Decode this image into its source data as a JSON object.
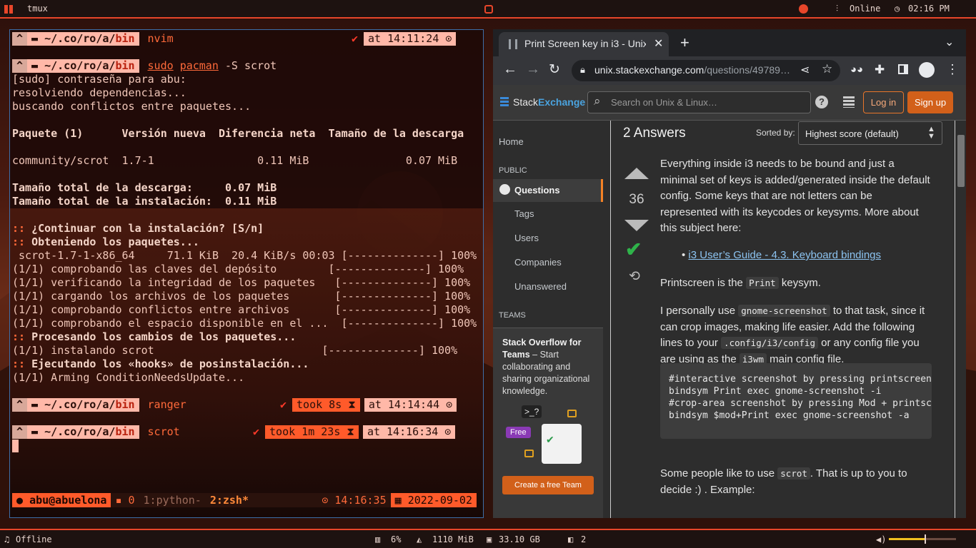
{
  "topbar": {
    "app": "tmux",
    "status": "Online",
    "clock": "02:16 PM"
  },
  "bottombar": {
    "music": "Offline",
    "cpu": "6%",
    "mem": "1110 MiB",
    "disk": "33.10 GB",
    "windows": "2"
  },
  "terminal": {
    "prompt_path": "~/.co/ro/a/",
    "prompt_bin": "bin",
    "prompt1": {
      "cmd": "nvim",
      "at": "at 14:11:24"
    },
    "prompt2": {
      "sudo": "sudo",
      "pacman": "pacman",
      "args": " -S scrot"
    },
    "lines": [
      "[sudo] contraseña para abu:",
      "resolviendo dependencias...",
      "buscando conflictos entre paquetes..."
    ],
    "table_header": "Paquete (1)      Versión nueva  Diferencia neta  Tamaño de la descarga",
    "table_row": "community/scrot  1.7-1                0.11 MiB               0.07 MiB",
    "totals": [
      "Tamaño total de la descarga:     0.07 MiB",
      "Tamaño total de la instalación:  0.11 MiB"
    ],
    "continue_q": "¿Continuar con la instalación? [S/n]",
    "getting": "Obteniendo los paquetes...",
    "dl_line": " scrot-1.7-1-x86_64     71.1 KiB  20.4 KiB/s 00:03 [--------------] 100%",
    "steps": [
      "(1/1) comprobando las claves del depósito        [--------------] 100%",
      "(1/1) verificando la integridad de los paquetes   [--------------] 100%",
      "(1/1) cargando los archivos de los paquetes       [--------------] 100%",
      "(1/1) comprobando conflictos entre archivos       [--------------] 100%",
      "(1/1) comprobando el espacio disponible en el ...  [--------------] 100%"
    ],
    "processing": "Procesando los cambios de los paquetes...",
    "installing": "(1/1) instalando scrot                          [--------------] 100%",
    "hooks": "Ejecutando los «hooks» de posinstalación...",
    "arming": "(1/1) Arming ConditionNeedsUpdate...",
    "prompt3": {
      "cmd": "ranger",
      "took": "took 8s",
      "at": "at 14:14:44"
    },
    "prompt4": {
      "cmd": "scrot",
      "took": "took 1m 23s",
      "at": "at 14:16:34"
    },
    "statusline": {
      "user": "abu@abuelona",
      "win0": "0",
      "win1": "1:python-",
      "win2": "2:zsh*",
      "time": "14:16:35",
      "date": "2022-09-02"
    }
  },
  "browser": {
    "tab_title": "Print Screen key in i3 - Unix",
    "url_host": "unix.stackexchange.com",
    "url_path": "/questions/49789…",
    "brand_a": "Stack",
    "brand_b": "Exchange",
    "search_placeholder": "Search on Unix & Linux…",
    "login": "Log in",
    "signup": "Sign up",
    "nav": {
      "home": "Home",
      "public": "PUBLIC",
      "questions": "Questions",
      "tags": "Tags",
      "users": "Users",
      "companies": "Companies",
      "unanswered": "Unanswered",
      "teams": "TEAMS"
    },
    "teams_promo": {
      "title": "Stack Overflow for Teams",
      "dash": " – Start collaborating and sharing organizational knowledge.",
      "free": "Free",
      "cta": "Create a free Team",
      "prompt_glyph": ">_?"
    },
    "answers_count": "2 Answers",
    "sorted_by": "Sorted by:",
    "sort_value": "Highest score (default)",
    "score": "36",
    "p1": "Everything inside i3 needs to be bound and just a minimal set of keys is added/generated inside the default config. Some keys that are not letters can be represented with its keycodes or keysyms. More about this subject here:",
    "link": "i3 User’s Guide - 4.3. Keyboard bindings",
    "p2a": "Printscreen is the ",
    "p2code": "Print",
    "p2b": " keysym.",
    "p3a": "I personally use ",
    "p3code1": "gnome-screenshot",
    "p3b": " to that task, since it can crop images, making life easier. Add the following lines to your ",
    "p3code2": ".config/i3/config",
    "p3c": " or any config file you are using as the ",
    "p3code3": "i3wm",
    "p3d": " main config file.",
    "code": "#interactive screenshot by pressing printscreen\nbindsym Print exec gnome-screenshot -i\n#crop-area screenshot by pressing Mod + printscreen\nbindsym $mod+Print exec gnome-screenshot -a",
    "p4a": "Some people like to use ",
    "p4code": "scrot",
    "p4b": ". That is up to you to decide :) . Example:"
  }
}
